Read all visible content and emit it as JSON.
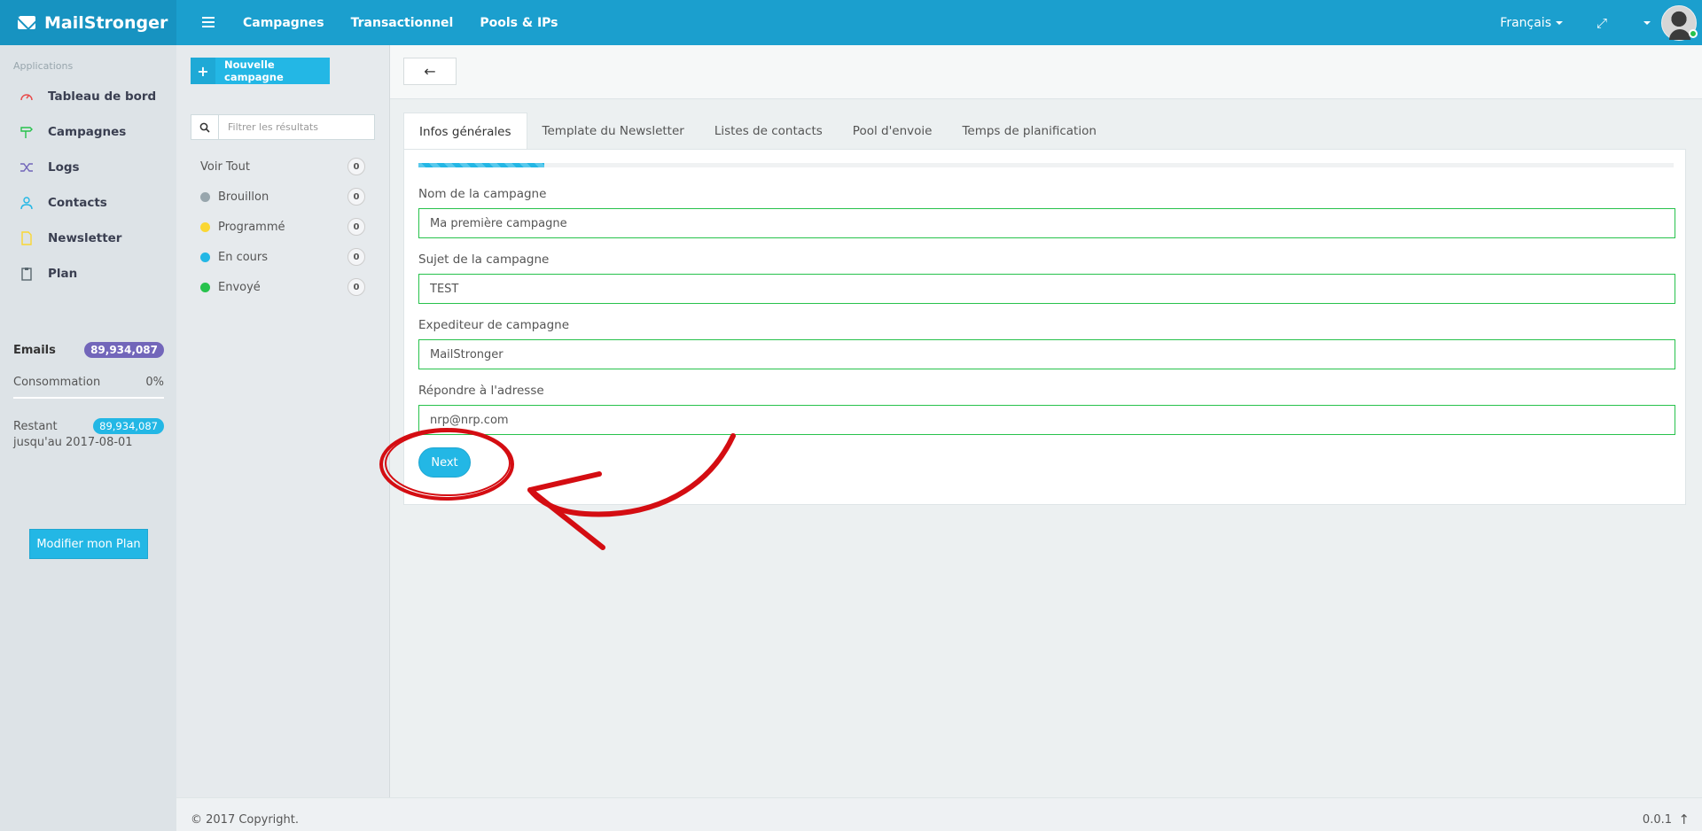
{
  "brand": {
    "name": "MailStronger"
  },
  "topnav": {
    "items": [
      "Campagnes",
      "Transactionnel",
      "Pools & IPs"
    ]
  },
  "topright": {
    "language": "Français"
  },
  "sidebar": {
    "heading": "Applications",
    "items": [
      {
        "label": "Tableau de bord",
        "icon": "dashboard-icon",
        "color": "#e84d4d"
      },
      {
        "label": "Campagnes",
        "icon": "signpost-icon",
        "color": "#27c24c"
      },
      {
        "label": "Logs",
        "icon": "shuffle-icon",
        "color": "#7266ba"
      },
      {
        "label": "Contacts",
        "icon": "contacts-icon",
        "color": "#23b7e5"
      },
      {
        "label": "Newsletter",
        "icon": "document-icon",
        "color": "#fad733"
      },
      {
        "label": "Plan",
        "icon": "clipboard-icon",
        "color": "#58666e"
      }
    ],
    "stats": {
      "emails_label": "Emails",
      "emails_value": "89,934,087",
      "conso_label": "Consommation",
      "conso_value": "0%",
      "restant_label": "Restant",
      "restant_value": "89,934,087",
      "until_label": "jusqu'au 2017-08-01"
    },
    "plan_button": "Modifier mon Plan"
  },
  "filters": {
    "new_button": "Nouvelle campagne",
    "search_placeholder": "Filtrer les résultats",
    "items": [
      {
        "label": "Voir Tout",
        "count": "0",
        "color": ""
      },
      {
        "label": "Brouillon",
        "count": "0",
        "color": "#98a6ad"
      },
      {
        "label": "Programmé",
        "count": "0",
        "color": "#fad733"
      },
      {
        "label": "En cours",
        "count": "0",
        "color": "#23b7e5"
      },
      {
        "label": "Envoyé",
        "count": "0",
        "color": "#27c24c"
      }
    ]
  },
  "main": {
    "back_glyph": "←",
    "tabs": [
      "Infos générales",
      "Template du Newsletter",
      "Listes de contacts",
      "Pool d'envoie",
      "Temps de planification"
    ],
    "progress_fraction": 0.1,
    "fields": [
      {
        "label": "Nom de la campagne",
        "value": "Ma première campagne"
      },
      {
        "label": "Sujet de la campagne",
        "value": "TEST"
      },
      {
        "label": "Expediteur de campagne",
        "value": "MailStronger"
      },
      {
        "label": "Répondre à l'adresse",
        "value": "nrp@nrp.com"
      }
    ],
    "next_button": "Next"
  },
  "footer": {
    "copyright": "© 2017 Copyright.",
    "version": "0.0.1"
  },
  "colors": {
    "primary": "#1b9fce",
    "accent": "#23b7e5",
    "success": "#27c24c",
    "annotation": "#d40d12"
  }
}
